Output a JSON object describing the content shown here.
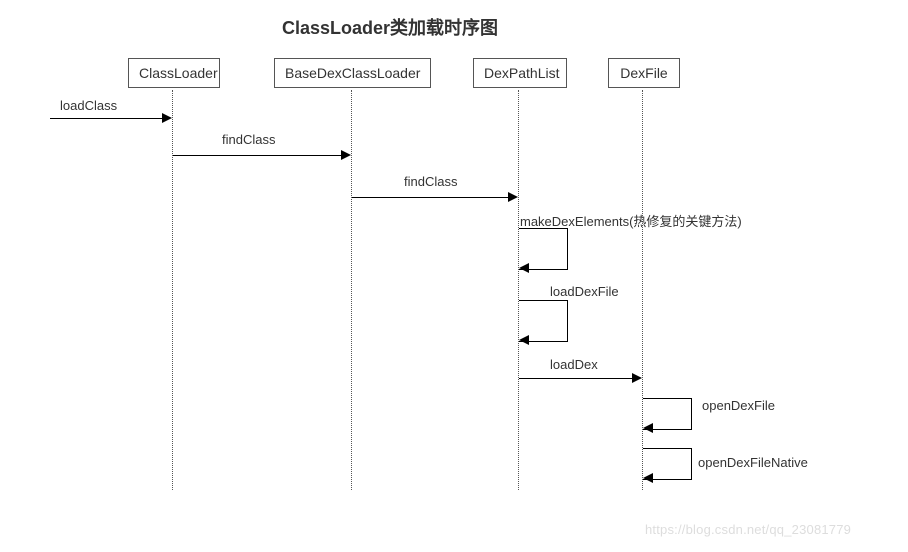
{
  "title": "ClassLoader类加载时序图",
  "participants": {
    "p1": "ClassLoader",
    "p2": "BaseDexClassLoader",
    "p3": "DexPathList",
    "p4": "DexFile"
  },
  "messages": {
    "m1": "loadClass",
    "m2": "findClass",
    "m3": "findClass",
    "m4": "makeDexElements(热修复的关键方法)",
    "m5": "loadDexFile",
    "m6": "loadDex",
    "m7": "openDexFile",
    "m8": "openDexFileNative"
  },
  "watermark": "https://blog.csdn.net/qq_23081779",
  "chart_data": {
    "type": "sequence_diagram",
    "title": "ClassLoader类加载时序图",
    "participants": [
      "ClassLoader",
      "BaseDexClassLoader",
      "DexPathList",
      "DexFile"
    ],
    "messages": [
      {
        "from": "(external)",
        "to": "ClassLoader",
        "label": "loadClass",
        "self": false
      },
      {
        "from": "ClassLoader",
        "to": "BaseDexClassLoader",
        "label": "findClass",
        "self": false
      },
      {
        "from": "BaseDexClassLoader",
        "to": "DexPathList",
        "label": "findClass",
        "self": false
      },
      {
        "from": "DexPathList",
        "to": "DexPathList",
        "label": "makeDexElements(热修复的关键方法)",
        "self": true
      },
      {
        "from": "DexPathList",
        "to": "DexPathList",
        "label": "loadDexFile",
        "self": true
      },
      {
        "from": "DexPathList",
        "to": "DexFile",
        "label": "loadDex",
        "self": false
      },
      {
        "from": "DexFile",
        "to": "DexFile",
        "label": "openDexFile",
        "self": true
      },
      {
        "from": "DexFile",
        "to": "DexFile",
        "label": "openDexFileNative",
        "self": true
      }
    ]
  }
}
